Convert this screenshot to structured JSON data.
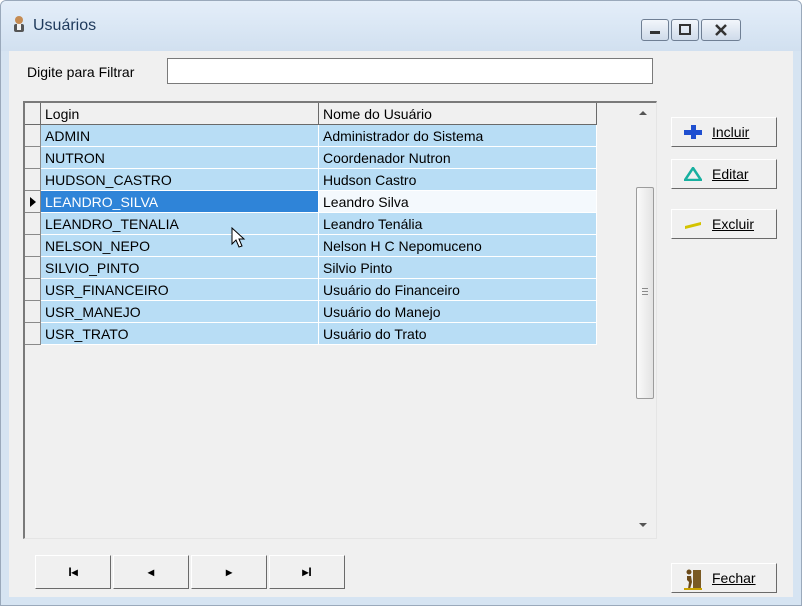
{
  "window": {
    "title": "Usuários",
    "icon": "users-icon"
  },
  "filter": {
    "label": "Digite para Filtrar",
    "value": ""
  },
  "grid": {
    "columns": [
      "Login",
      "Nome do Usuário"
    ],
    "rows": [
      [
        "ADMIN",
        "Administrador do Sistema"
      ],
      [
        "NUTRON",
        "Coordenador Nutron"
      ],
      [
        "HUDSON_CASTRO",
        "Hudson Castro"
      ],
      [
        "LEANDRO_SILVA",
        "Leandro Silva"
      ],
      [
        "LEANDRO_TENALIA",
        "Leandro Tenália"
      ],
      [
        "NELSON_NEPO",
        "Nelson H C Nepomuceno"
      ],
      [
        "SILVIO_PINTO",
        "Silvio Pinto"
      ],
      [
        "USR_FINANCEIRO",
        "Usuário do Financeiro"
      ],
      [
        "USR_MANEJO",
        "Usuário do Manejo"
      ],
      [
        "USR_TRATO",
        "Usuário do Trato"
      ]
    ],
    "selected_login": "LEANDRO_SILVA"
  },
  "actions": {
    "incluir": "Incluir",
    "editar": "Editar",
    "excluir": "Excluir",
    "fechar": "Fechar"
  },
  "navigator": {
    "first": "I◂",
    "prior": "◂",
    "next": "▸",
    "last": "▸I"
  },
  "colors": {
    "row": "#b8ddf5",
    "selected": "#2f84d8",
    "incluir_icon": "#1f4fd0",
    "editar_icon": "#18b0a0",
    "excluir_icon": "#d4c300"
  }
}
